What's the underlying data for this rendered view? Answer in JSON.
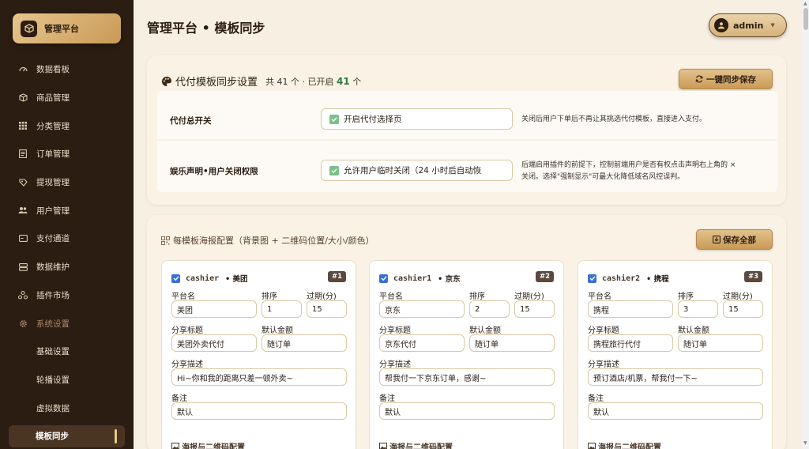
{
  "sidebar": {
    "brand": "管理平台",
    "items": [
      {
        "label": "数据看板",
        "icon": "dashboard-icon"
      },
      {
        "label": "商品管理",
        "icon": "cube-icon"
      },
      {
        "label": "分类管理",
        "icon": "grid-icon"
      },
      {
        "label": "订单管理",
        "icon": "list-icon"
      },
      {
        "label": "提现管理",
        "icon": "wallet-icon"
      },
      {
        "label": "用户管理",
        "icon": "users-icon"
      },
      {
        "label": "支付通道",
        "icon": "card-icon"
      },
      {
        "label": "数据维护",
        "icon": "database-icon"
      },
      {
        "label": "插件市场",
        "icon": "puzzle-icon"
      },
      {
        "label": "系统设置",
        "icon": "gear-icon"
      }
    ],
    "subitems": [
      "基础设置",
      "轮播设置",
      "虚拟数据",
      "模板同步"
    ],
    "active": "模板同步"
  },
  "header": {
    "title": "管理平台 • 模板同步",
    "user": "admin"
  },
  "sync_card": {
    "title": "代付模板同步设置",
    "count_prefix": "共 41 个 · 已开启",
    "count_enabled": "41",
    "count_suffix": "个",
    "sync_button": "一键同步保存",
    "rows": [
      {
        "label": "代付总开关",
        "checkbox": "开启代付选择页",
        "desc": "关闭后用户下单后不再让其挑选代付模板，直接进入支付。"
      },
      {
        "label": "娱乐声明•用户关闭权限",
        "checkbox": "允许用户临时关闭（24 小时后自动恢",
        "desc1": "后端启用插件的前提下，控制前端用户是否有权点击声明右上角的 ×",
        "desc2": "关闭。选择\"强制显示\"可最大化降低域名风控误判。"
      }
    ]
  },
  "poster_card": {
    "title": "每模板海报配置（背景图 + 二维码位置/大小/颜色）",
    "save_all": "保存全部",
    "labels": {
      "platform": "平台名",
      "sort": "排序",
      "expire": "过期(分)",
      "share_title": "分享标题",
      "default_amount": "默认金额",
      "share_desc": "分享描述",
      "remark": "备注",
      "poster": "海报与二维码配置"
    },
    "templates": [
      {
        "code": "cashier",
        "name": "美团",
        "badge": "#1",
        "platform": "美团",
        "sort": "1",
        "expire": "15",
        "share_title": "美团外卖代付",
        "amount": "随订单",
        "share_desc": "Hi~你和我的距离只差一顿外卖~",
        "remark": "默认"
      },
      {
        "code": "cashier1",
        "name": "京东",
        "badge": "#2",
        "platform": "京东",
        "sort": "2",
        "expire": "15",
        "share_title": "京东代付",
        "amount": "随订单",
        "share_desc": "帮我付一下京东订单，感谢~",
        "remark": "默认"
      },
      {
        "code": "cashier2",
        "name": "携程",
        "badge": "#3",
        "platform": "携程",
        "sort": "3",
        "expire": "15",
        "share_title": "携程旅行代付",
        "amount": "随订单",
        "share_desc": "预订酒店/机票，帮我付一下~",
        "remark": "默认"
      }
    ]
  }
}
